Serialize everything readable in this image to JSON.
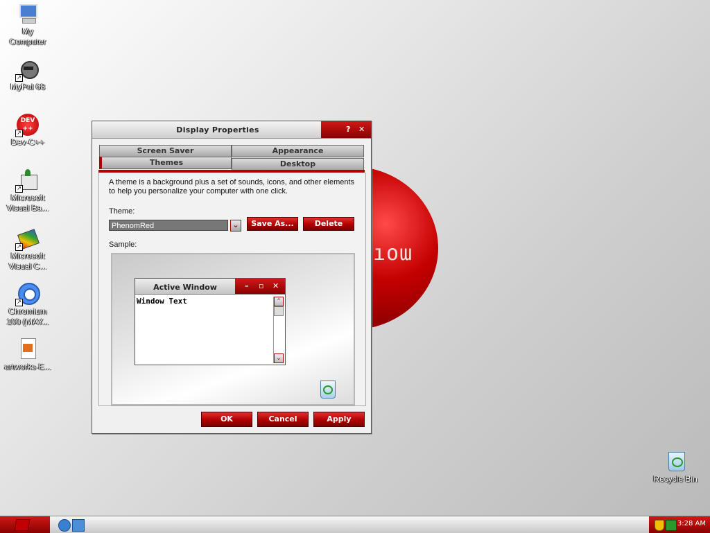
{
  "desktop": {
    "icons": [
      {
        "label_lines": [
          "My",
          "Computer"
        ]
      },
      {
        "label_lines": [
          "MyPal 68"
        ]
      },
      {
        "label_lines": [
          "Dev-C++"
        ]
      },
      {
        "label_lines": [
          "Microsoft",
          "Visual Ba..."
        ]
      },
      {
        "label_lines": [
          "Microsoft",
          "Visual C..."
        ]
      },
      {
        "label_lines": [
          "Chromium",
          "100 (MAY..."
        ]
      },
      {
        "label_lines": [
          "artworks-E..."
        ]
      },
      {
        "label_lines": [
          "Recycle Bin"
        ]
      }
    ],
    "wallpaper_text": "ıoɯ",
    "dev_icon_text": "DEV ++"
  },
  "dialog": {
    "title": "Display Properties",
    "help_btn": "?",
    "close_btn": "✕",
    "tabs": {
      "screen_saver": "Screen Saver",
      "appearance": "Appearance",
      "themes": "Themes",
      "desktop": "Desktop"
    },
    "description": "A theme is a background plus a set of sounds, icons, and other elements to help you personalize your computer with one click.",
    "theme_label": "Theme:",
    "theme_value": "PhenomRed",
    "save_as": "Save As...",
    "delete": "Delete",
    "sample_label": "Sample:",
    "sample": {
      "window_title": "Active Window",
      "window_text": "Window Text",
      "min": "–",
      "max": "▫",
      "close": "✕"
    },
    "ok": "OK",
    "cancel": "Cancel",
    "apply": "Apply"
  },
  "taskbar": {
    "clock": "3:28 AM"
  },
  "colors": {
    "accent_red": "#b00000",
    "accent_red_light": "#e03030"
  }
}
